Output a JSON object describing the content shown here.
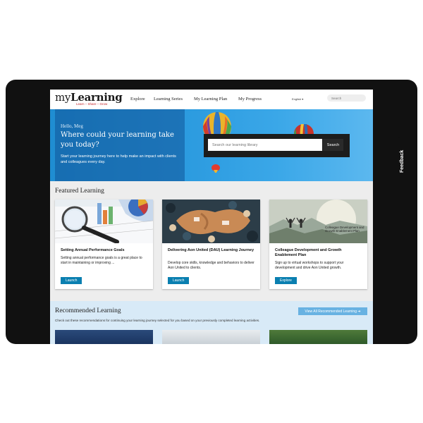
{
  "header": {
    "logo_prefix": "my",
    "logo_name": "Learning",
    "tagline": "Learn – Share – Grow",
    "nav": [
      "Explore",
      "Learning Series",
      "My Learning Plan",
      "My Progress"
    ],
    "language": "English ▾",
    "search_placeholder": "Search"
  },
  "hero": {
    "greeting": "Hello, Meg",
    "headline": "Where could your learning take you today?",
    "subtext": "Start your learning journey here to help make an impact with clients and colleagues every day.",
    "search_placeholder": "Search our learning library",
    "search_button": "Search"
  },
  "feedback_tab": "Feedback",
  "featured": {
    "title": "Featured Learning",
    "cards": [
      {
        "title": "Setting Annual Performance Goals",
        "description": "Setting annual performance goals is a great place to start in maintaining or improving ...",
        "button": "Launch"
      },
      {
        "title": "Delivering Aon United (DAU) Learning Journey",
        "description": "Develop core skills, knowledge and behaviors to deliver Aon United to clients.",
        "button": "Launch"
      },
      {
        "title": "Colleague Development and Growth Enablement Plan",
        "description": "Sign up to virtual workshops to support your development and drive Aon United growth.",
        "button": "Explore",
        "image_caption": "Colleague Development and Growth Enablement Plan"
      }
    ]
  },
  "recommended": {
    "title": "Recommended Learning",
    "button": "View All Recommended Learning ➔",
    "description": "Check out these recommendations for continuing your learning journey selected for you based on your previously completed learning activities."
  },
  "colors": {
    "accent": "#0a7fb0",
    "hero_blue": "#2d9ce0",
    "brand_red": "#c2272d",
    "featured_bg": "#ededed",
    "recommended_bg": "#d8eaf7"
  }
}
